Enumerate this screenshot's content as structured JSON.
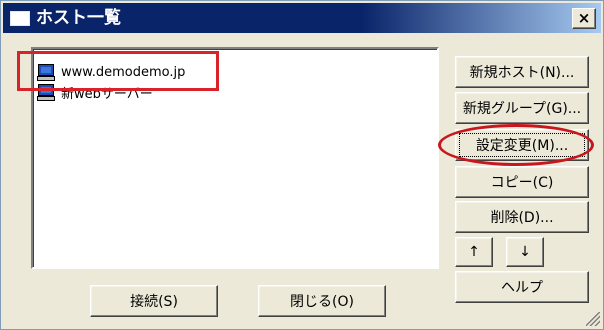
{
  "window": {
    "title": "ホスト一覧",
    "close_label": "×"
  },
  "hosts": [
    {
      "name": "www.demodemo.jp",
      "icon": "computer-icon"
    },
    {
      "name": "新webサーバー",
      "icon": "computer-icon"
    }
  ],
  "buttons": {
    "new_host": "新規ホスト(N)...",
    "new_group": "新規グループ(G)...",
    "change_settings": "設定変更(M)...",
    "copy": "コピー(C)",
    "delete": "削除(D)...",
    "move_up": "↑",
    "move_down": "↓",
    "help": "ヘルプ",
    "connect": "接続(S)",
    "close": "閉じる(O)"
  },
  "colors": {
    "annotation_red": "#d9232a",
    "titlebar": "#0a246a"
  }
}
